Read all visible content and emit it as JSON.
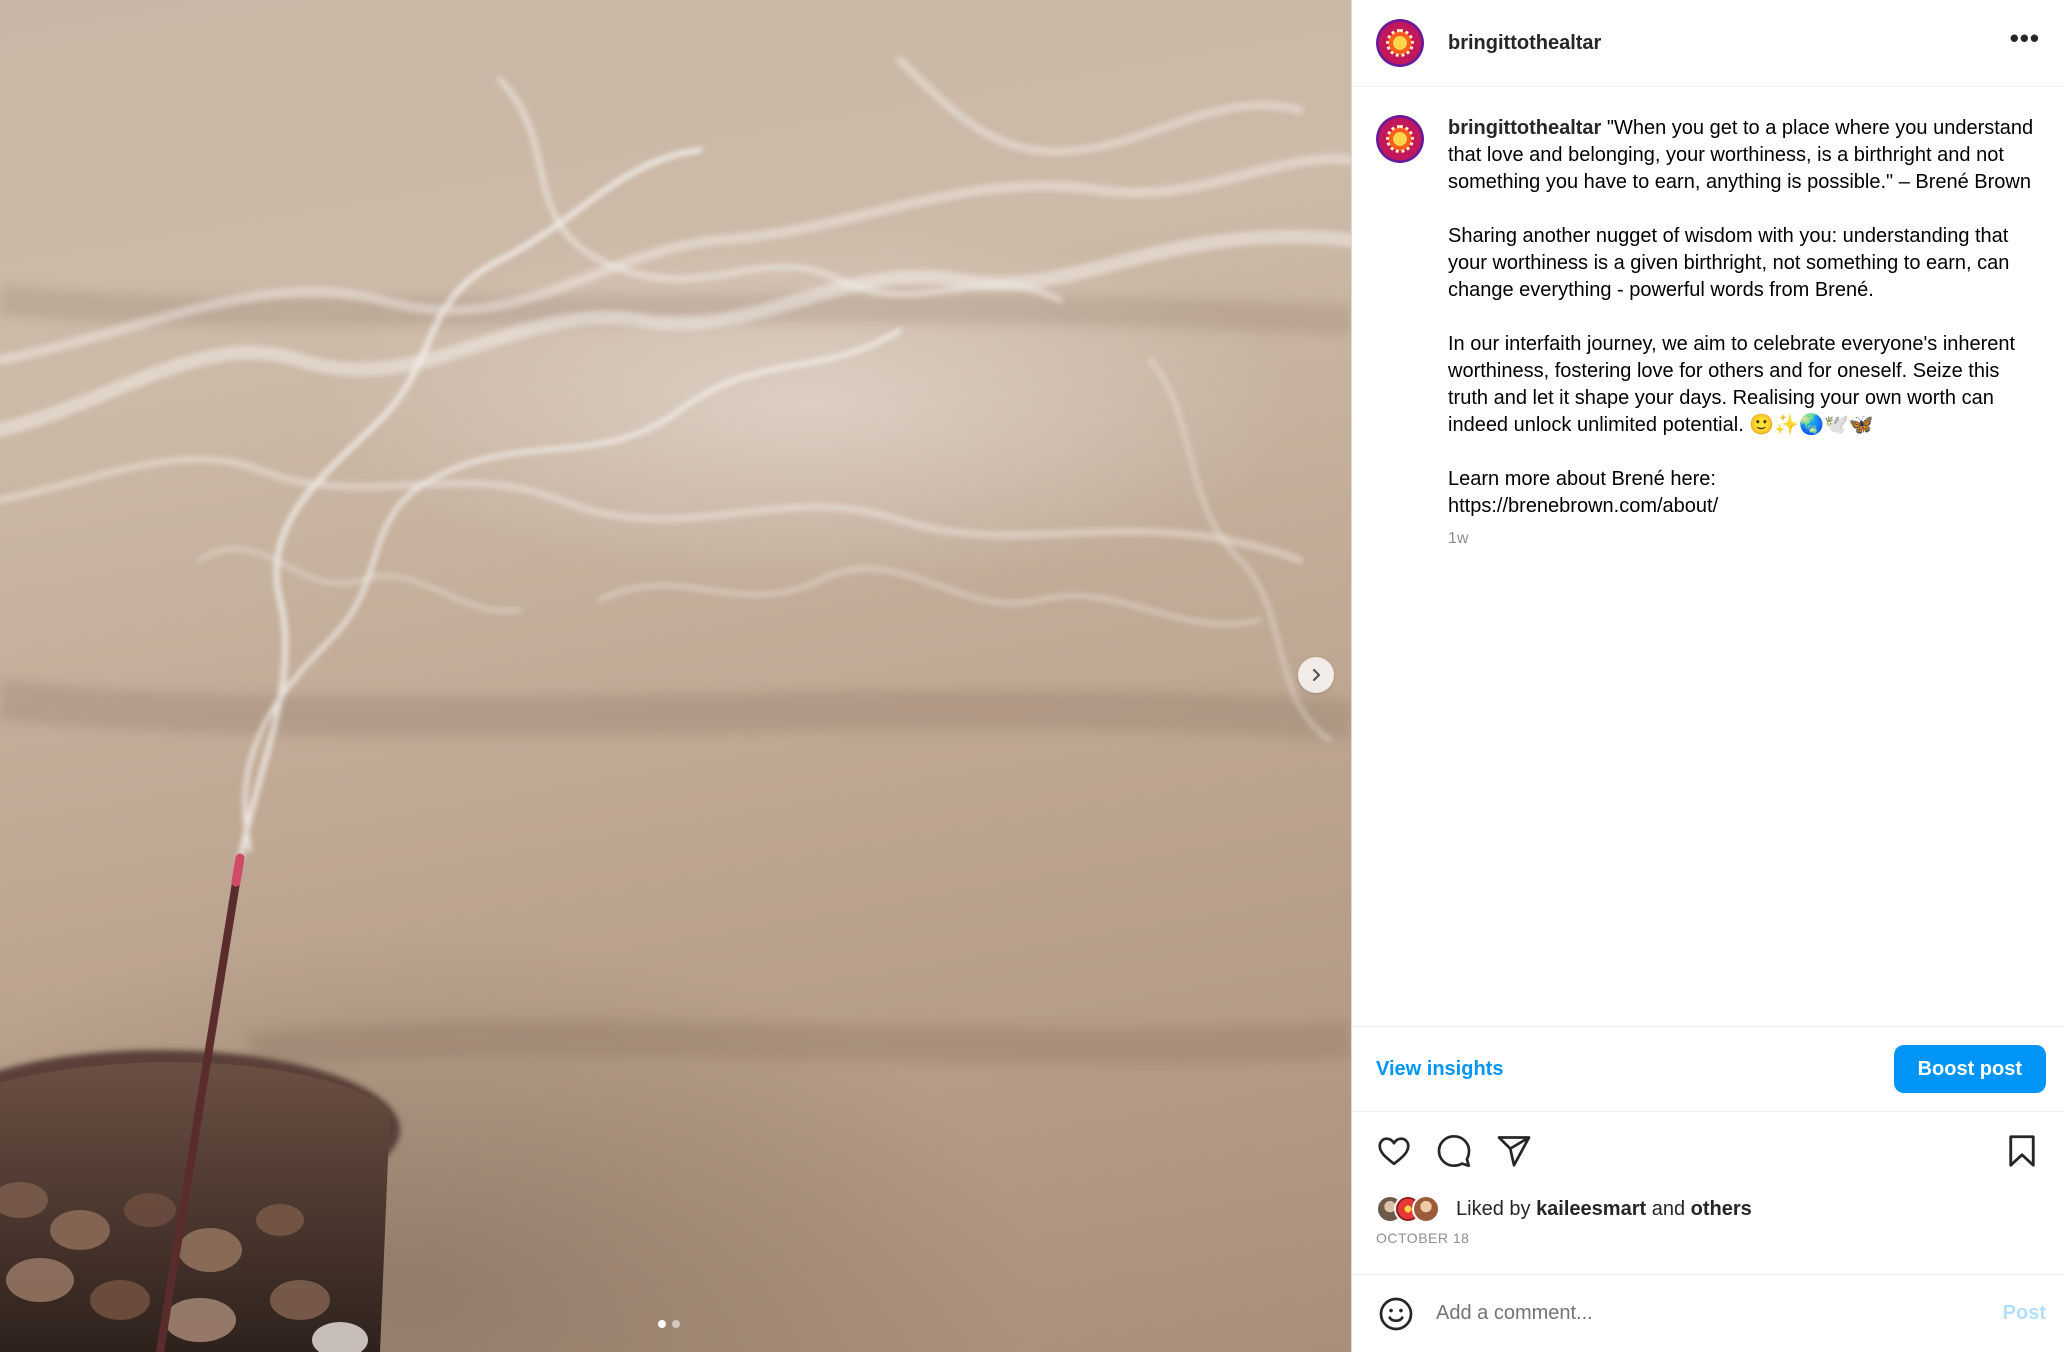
{
  "post": {
    "username": "bringittothealtar",
    "more_icon": "•••",
    "caption_text": "\"When you get to a place where you understand that love and belonging, your worthiness, is a birthright and not something you have to earn, anything is possible.\" – Brené Brown\n\nSharing another nugget of wisdom with you: understanding that your worthiness is a given birthright, not something to earn, can change everything - powerful words from Brené.\n\nIn our interfaith journey, we aim to celebrate everyone's inherent worthiness, fostering love for others and for oneself. Seize this truth and let it shape your days. Realising your own worth can indeed unlock unlimited potential. 🙂✨🌏🕊️🦋\n\nLearn more about Brené here:\nhttps://brenebrown.com/about/",
    "time_ago": "1w",
    "date": "OCTOBER 18"
  },
  "insights": {
    "view_label": "View insights",
    "boost_label": "Boost post"
  },
  "likes": {
    "prefix": "Liked by ",
    "user": "kaileesmart",
    "middle": " and ",
    "others": "others"
  },
  "comment": {
    "placeholder": "Add a comment...",
    "post_label": "Post"
  },
  "carousel": {
    "total": 2,
    "current": 1
  },
  "colors": {
    "accent": "#0095f6",
    "text": "#262626",
    "muted": "#8e8e8e",
    "post_disabled": "#b2dffc"
  }
}
